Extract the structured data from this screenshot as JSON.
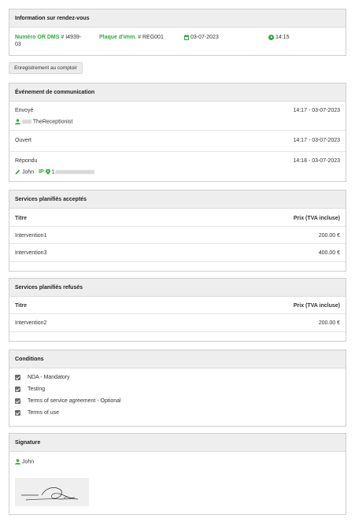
{
  "appointment": {
    "title": "Information sur rendez-vous",
    "dms_label": "Numéro OR DMS",
    "dms_value_1": "I4939-",
    "dms_value_2": "03",
    "plate_label": "Plaque d'imm.",
    "plate_value": "REG001",
    "date": "03-07-2023",
    "time": "14:15"
  },
  "checkin_button": "Enregistrement au comptoir",
  "communication": {
    "title": "Événement de communication",
    "sent_label": "Envoyé",
    "sent_time": "14:17 - 03-07-2023",
    "receptionist": "TheReceptionist",
    "opened_label": "Ouvert",
    "opened_time": "14:17 - 03-07-2023",
    "replied_label": "Répondu",
    "replied_time": "14:18 - 03-07-2023",
    "replier": "John",
    "ip_label": "IP",
    "ip_prefix": "1"
  },
  "accepted": {
    "title": "Services planifiés acceptés",
    "col_title": "Titre",
    "col_price": "Prix (TVA incluse)",
    "rows": [
      {
        "name": "Intervention1",
        "price": "200.00 €"
      },
      {
        "name": "Intervention3",
        "price": "400.00 €"
      }
    ]
  },
  "refused": {
    "title": "Services planifiés refusés",
    "col_title": "Titre",
    "col_price": "Prix (TVA incluse)",
    "rows": [
      {
        "name": "Intervention2",
        "price": "200.00 €"
      }
    ]
  },
  "conditions": {
    "title": "Conditions",
    "items": [
      "NDA - Mandatory",
      "Testing",
      "Terms of service agreement - Optional",
      "Terms of use"
    ]
  },
  "signature": {
    "title": "Signature",
    "signer": "John"
  },
  "colors": {
    "accent": "#2eaa3c",
    "header_bg": "#eeeeee",
    "border": "#cfcfcf"
  }
}
